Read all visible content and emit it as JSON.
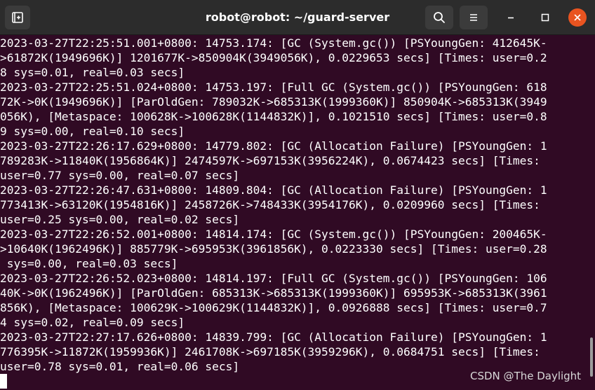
{
  "window": {
    "title": "robot@robot: ~/guard-server"
  },
  "icons": {
    "new_tab": "new-tab-icon",
    "search": "search-icon",
    "menu": "hamburger-menu-icon",
    "minimize": "minimize-icon",
    "maximize": "maximize-icon",
    "close": "close-icon"
  },
  "colors": {
    "terminal_bg": "#300a24",
    "titlebar_bg": "#2c2c2c",
    "close_button": "#e95420",
    "text": "#ffffff"
  },
  "terminal": {
    "lines": [
      "2023-03-27T22:25:51.001+0800: 14753.174: [GC (System.gc()) [PSYoungGen: 412645K-",
      ">61872K(1949696K)] 1201677K->850904K(3949056K), 0.0229653 secs] [Times: user=0.2",
      "8 sys=0.01, real=0.03 secs]",
      "2023-03-27T22:25:51.024+0800: 14753.197: [Full GC (System.gc()) [PSYoungGen: 618",
      "72K->0K(1949696K)] [ParOldGen: 789032K->685313K(1999360K)] 850904K->685313K(3949",
      "056K), [Metaspace: 100628K->100628K(1144832K)], 0.1021510 secs] [Times: user=0.8",
      "9 sys=0.00, real=0.10 secs]",
      "2023-03-27T22:26:17.629+0800: 14779.802: [GC (Allocation Failure) [PSYoungGen: 1",
      "789283K->11840K(1956864K)] 2474597K->697153K(3956224K), 0.0674423 secs] [Times:",
      "user=0.77 sys=0.00, real=0.07 secs]",
      "2023-03-27T22:26:47.631+0800: 14809.804: [GC (Allocation Failure) [PSYoungGen: 1",
      "773413K->63120K(1954816K)] 2458726K->748433K(3954176K), 0.0209960 secs] [Times:",
      "user=0.25 sys=0.00, real=0.02 secs]",
      "2023-03-27T22:26:52.001+0800: 14814.174: [GC (System.gc()) [PSYoungGen: 200465K-",
      ">10640K(1962496K)] 885779K->695953K(3961856K), 0.0223330 secs] [Times: user=0.28",
      " sys=0.00, real=0.03 secs]",
      "2023-03-27T22:26:52.023+0800: 14814.197: [Full GC (System.gc()) [PSYoungGen: 106",
      "40K->0K(1962496K)] [ParOldGen: 685313K->685313K(1999360K)] 695953K->685313K(3961",
      "856K), [Metaspace: 100629K->100629K(1144832K)], 0.0926888 secs] [Times: user=0.7",
      "4 sys=0.02, real=0.09 secs]",
      "2023-03-27T22:27:17.626+0800: 14839.799: [GC (Allocation Failure) [PSYoungGen: 1",
      "776395K->11872K(1959936K)] 2461708K->697185K(3959296K), 0.0684751 secs] [Times:",
      "user=0.78 sys=0.01, real=0.06 secs]"
    ]
  },
  "watermark": {
    "text": "CSDN @The Daylight"
  }
}
